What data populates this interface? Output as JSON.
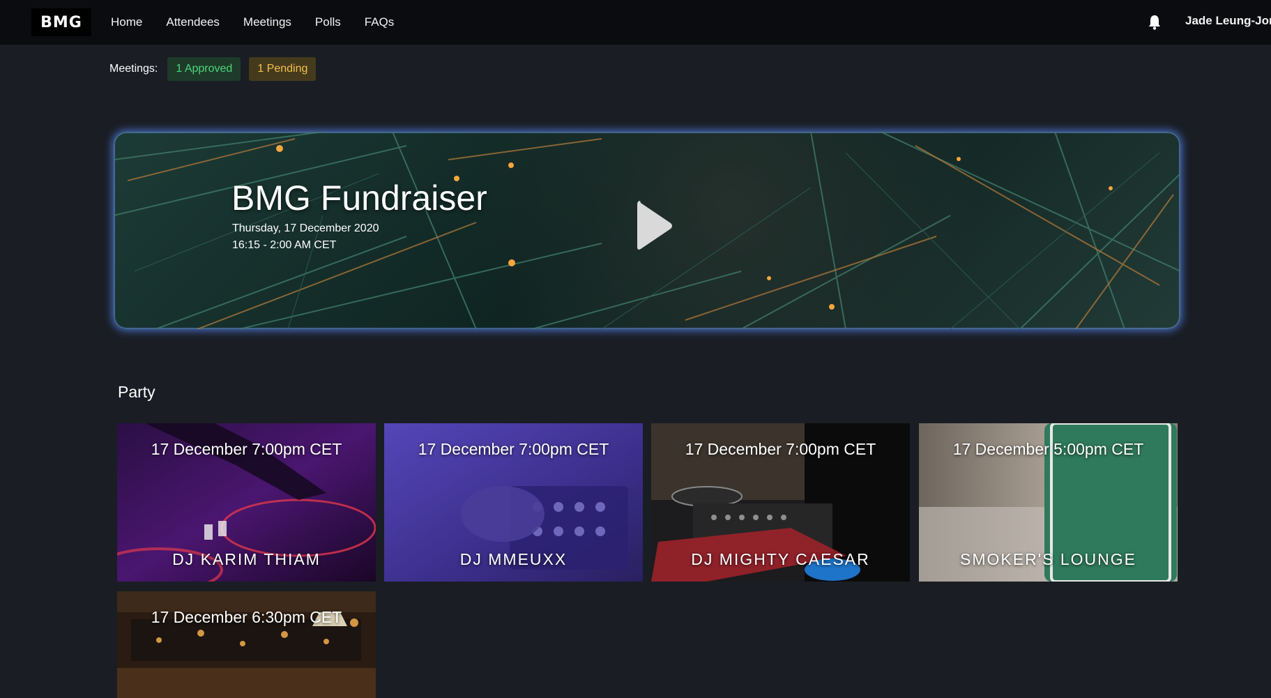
{
  "header": {
    "logo": "BMG",
    "nav": [
      "Home",
      "Attendees",
      "Meetings",
      "Polls",
      "FAQs"
    ],
    "user_name": "Jade Leung-Jon"
  },
  "meetings": {
    "label": "Meetings:",
    "approved": "1 Approved",
    "pending": "1 Pending"
  },
  "hero": {
    "title": "BMG Fundraiser",
    "date": "Thursday, 17 December 2020",
    "time": "16:15 - 2:00 AM CET"
  },
  "section": {
    "title": "Party",
    "cards": [
      {
        "date": "17 December 7:00pm CET",
        "name": "DJ KARIM THIAM"
      },
      {
        "date": "17 December 7:00pm CET",
        "name": "DJ MMEUXX"
      },
      {
        "date": "17 December 7:00pm CET",
        "name": "DJ MIGHTY CAESAR"
      },
      {
        "date": "17 December 5:00pm CET",
        "name": "SMOKER'S LOUNGE"
      },
      {
        "date": "17 December 6:30pm CET",
        "name": ""
      }
    ]
  },
  "colors": {
    "background": "#1a1d24",
    "topbar": "#0b0c0f",
    "approved": "#4cd57a",
    "pending": "#f2c14e",
    "hero_glow": "#5a8cff"
  },
  "icons": {
    "notifications": "bell-icon",
    "hero_action": "play-icon"
  }
}
